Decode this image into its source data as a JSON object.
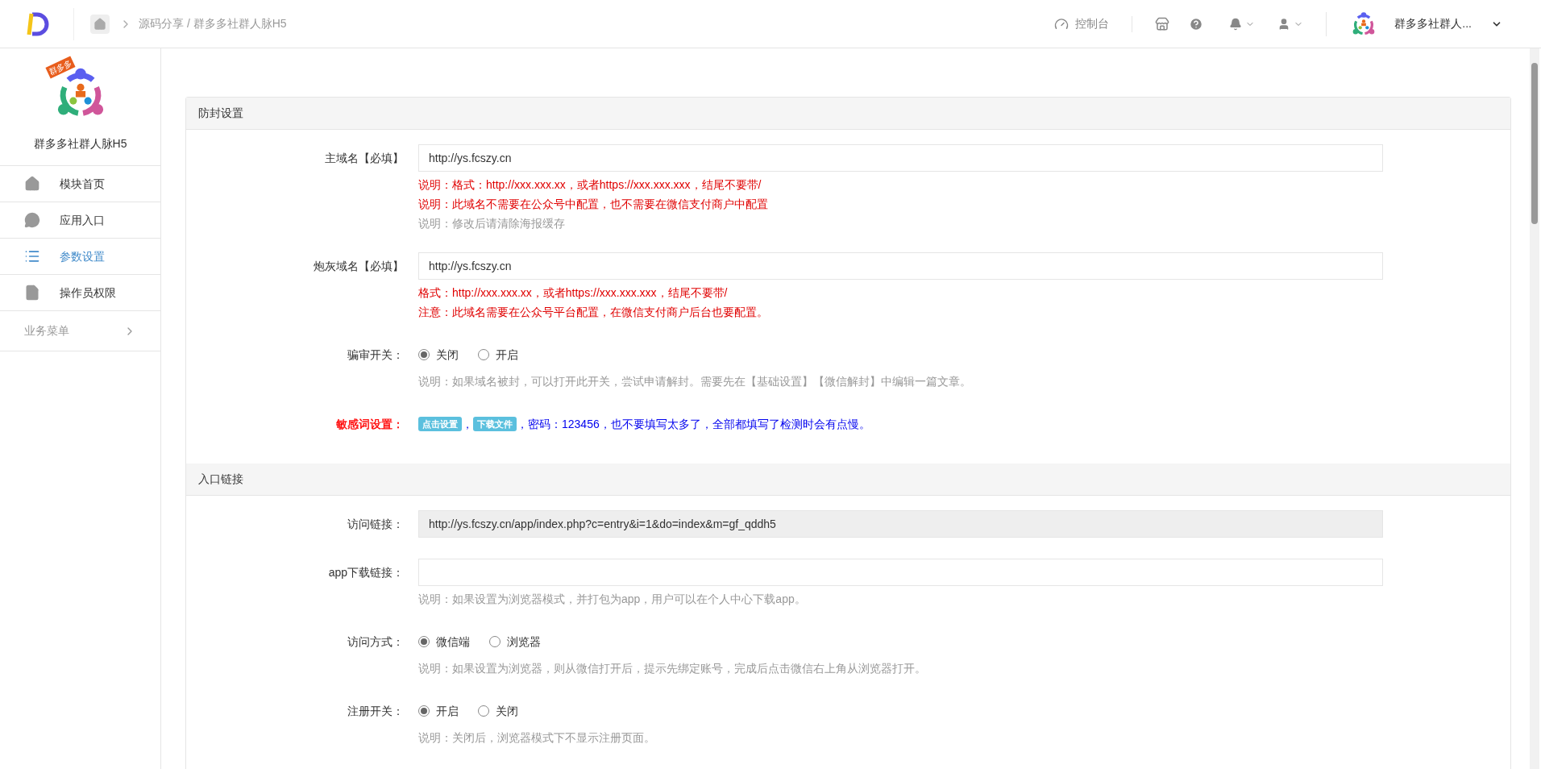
{
  "topbar": {
    "breadcrumb": "源码分享 / 群多多社群人脉H5",
    "console": "控制台",
    "account": "群多多社群人..."
  },
  "sidebar": {
    "app_name": "群多多社群人脉H5",
    "badge": "群多多",
    "items": [
      {
        "label": "模块首页",
        "selected": false
      },
      {
        "label": "应用入口",
        "selected": false
      },
      {
        "label": "参数设置",
        "selected": true
      },
      {
        "label": "操作员权限",
        "selected": false
      }
    ],
    "group": "业务菜单"
  },
  "sections": [
    {
      "title": "防封设置",
      "fields": [
        {
          "kind": "input",
          "label": "主域名【必填】",
          "value": "http://ys.fcszy.cn",
          "notes": [
            {
              "text": "说明：格式：http://xxx.xxx.xx，或者https://xxx.xxx.xxx，结尾不要带/",
              "color": "#e00000"
            },
            {
              "text": "说明：此域名不需要在公众号中配置，也不需要在微信支付商户中配置",
              "color": "#e00000"
            },
            {
              "text": "说明：修改后请清除海报缓存",
              "color": "#999999"
            }
          ]
        },
        {
          "kind": "input",
          "label": "炮灰域名【必填】",
          "value": "http://ys.fcszy.cn",
          "notes": [
            {
              "text": "格式：http://xxx.xxx.xx，或者https://xxx.xxx.xxx，结尾不要带/",
              "color": "#e00000"
            },
            {
              "text": "注意：此域名需要在公众号平台配置，在微信支付商户后台也要配置。",
              "color": "#e00000"
            }
          ]
        },
        {
          "kind": "radio",
          "label": "骗审开关：",
          "options": [
            {
              "label": "关闭",
              "selected": true
            },
            {
              "label": "开启",
              "selected": false
            }
          ],
          "notes": [
            {
              "text": "说明：如果域名被封，可以打开此开关，尝试申请解封。需要先在【基础设置】【微信解封】中编辑一篇文章。",
              "color": "#999999"
            }
          ]
        },
        {
          "kind": "tags",
          "label": "敏感词设置：",
          "color": "#ff0000",
          "tags": [
            "点击设置",
            "下载文件"
          ],
          "separator": "，",
          "message": "，密码：123456，也不要填写太多了，全部都填写了检测时会有点慢。"
        }
      ]
    },
    {
      "title": "入口链接",
      "fields": [
        {
          "kind": "readonly",
          "label": "访问链接：",
          "value": "http://ys.fcszy.cn/app/index.php?c=entry&i=1&do=index&m=gf_qddh5"
        },
        {
          "kind": "input",
          "label": "app下载链接：",
          "notes": [
            {
              "text": "说明：如果设置为浏览器模式，并打包为app，用户可以在个人中心下载app。",
              "color": "#999999"
            }
          ]
        },
        {
          "kind": "radio",
          "label": "访问方式：",
          "options": [
            {
              "label": "微信端",
              "selected": true
            },
            {
              "label": "浏览器",
              "selected": false
            }
          ],
          "notes": [
            {
              "text": "说明：如果设置为浏览器，则从微信打开后，提示先绑定账号，完成后点击微信右上角从浏览器打开。",
              "color": "#999999"
            }
          ]
        },
        {
          "kind": "radio",
          "label": "注册开关：",
          "options": [
            {
              "label": "开启",
              "selected": true
            },
            {
              "label": "关闭",
              "selected": false
            }
          ],
          "notes": [
            {
              "text": "说明：关闭后，浏览器模式下不显示注册页面。",
              "color": "#999999"
            }
          ]
        }
      ]
    }
  ]
}
